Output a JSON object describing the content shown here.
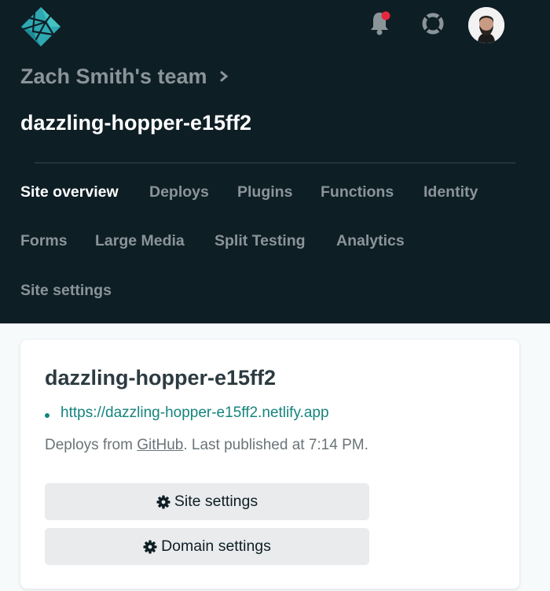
{
  "header": {
    "logo_icon": "netlify-logo-icon",
    "notification_icon": "bell-icon",
    "notification_badge_color": "#e5283b",
    "help_icon": "lifebuoy-icon",
    "avatar_icon": "user-avatar",
    "team_name": "Zach Smith's team",
    "site_name": "dazzling-hopper-e15ff2"
  },
  "nav": {
    "items": [
      {
        "label": "Site overview",
        "active": true
      },
      {
        "label": "Deploys"
      },
      {
        "label": "Plugins"
      },
      {
        "label": "Functions"
      },
      {
        "label": "Identity"
      },
      {
        "label": "Forms"
      },
      {
        "label": "Large Media"
      },
      {
        "label": "Split Testing"
      },
      {
        "label": "Analytics"
      },
      {
        "label": "Site settings"
      }
    ]
  },
  "card": {
    "title": "dazzling-hopper-e15ff2",
    "url": "https://dazzling-hopper-e15ff2.netlify.app",
    "deploy_prefix": "Deploys from ",
    "deploy_source": "GitHub",
    "deploy_suffix": ". Last published at 7:14 PM.",
    "buttons": {
      "site_settings": "Site settings",
      "domain_settings": "Domain settings"
    }
  },
  "colors": {
    "header_bg": "#0e1e25",
    "accent_teal": "#15847d",
    "nav_inactive": "#8a9499"
  }
}
